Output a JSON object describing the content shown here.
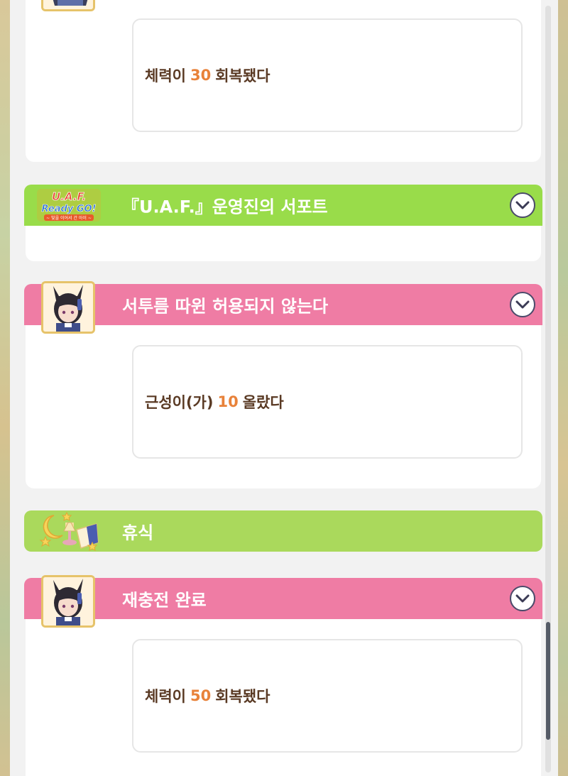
{
  "events": [
    {
      "type": "message",
      "prefix": "체력이",
      "value": "30",
      "suffix": "회복됐다"
    },
    {
      "type": "header",
      "title": "『U.A.F.』운영진의 서포트",
      "color": "#99dc4a",
      "icon": "uaf-logo"
    },
    {
      "type": "header",
      "title": "서투름 따윈 허용되지 않는다",
      "color": "#ef7ca4",
      "icon": "character-portrait"
    },
    {
      "type": "message",
      "prefix": "근성이(가)",
      "value": "10",
      "suffix": "올랐다"
    },
    {
      "type": "header",
      "title": "휴식",
      "color": "#aad95c",
      "icon": "rest-icon"
    },
    {
      "type": "header",
      "title": "재충전 완료",
      "color": "#ef7ca4",
      "icon": "character-portrait"
    },
    {
      "type": "message",
      "prefix": "체력이",
      "value": "50",
      "suffix": "회복됐다"
    }
  ],
  "uaf_logo": {
    "line1": "U.A.F.",
    "line2": "Ready GO!",
    "line3": "~ 빛을 이어서 간 아이 ~"
  },
  "colors": {
    "accent_value": "#e8823a",
    "text_brown": "#5a3a24",
    "pink": "#ef7ca4",
    "green": "#99dc4a"
  }
}
